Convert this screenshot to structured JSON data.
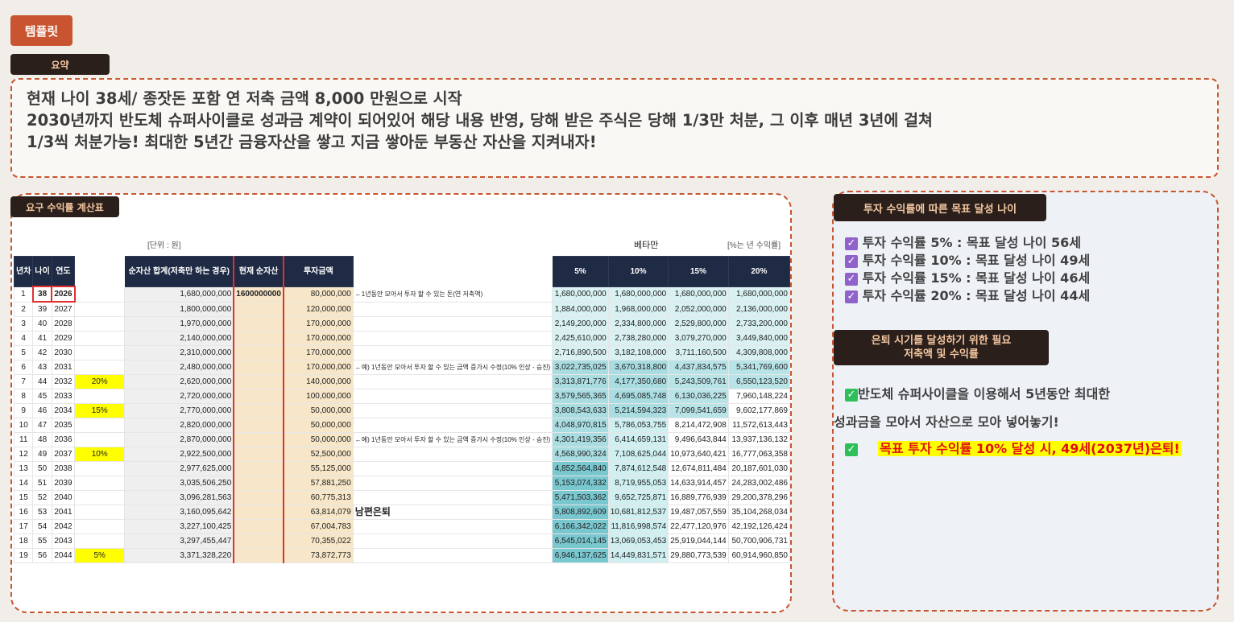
{
  "template_label": "템플릿",
  "summary": {
    "tag": "요약",
    "lines": [
      "현재 나이 38세/ 종잣돈 포함 연 저축 금액 8,000 만원으로 시작",
      "2030년까지 반도체 슈퍼사이클로 성과금 계약이 되어있어 해당 내용 반영, 당해 받은 주식은 당해 1/3만 처분, 그 이후 매년 3년에 걸쳐",
      "1/3씩 처분가능! 최대한 5년간 금융자산을 쌓고 지금 쌓아둔 부동산 자산을 지켜내자!"
    ]
  },
  "calc": {
    "tag": "요구 수익률 계산표",
    "unit_label": "[단위 : 원]",
    "beta_label": "베타만",
    "annual_return_label": "[%는 년 수익률]",
    "headers": [
      "년차",
      "나이",
      "연도",
      "",
      "순자산 합계(저축만 하는 경우)",
      "현재 순자산",
      "투자금액",
      "",
      "5%",
      "10%",
      "15%",
      "20%"
    ],
    "rows": [
      [
        "1",
        "38",
        "2026",
        "",
        "1,680,000,000",
        "1600000000",
        "80,000,000",
        "←1년동안 모아서 투자 할 수 있는 돈(연 저축액)",
        "1,680,000,000",
        "1,680,000,000",
        "1,680,000,000",
        "1,680,000,000"
      ],
      [
        "2",
        "39",
        "2027",
        "",
        "1,800,000,000",
        "",
        "120,000,000",
        "",
        "1,884,000,000",
        "1,968,000,000",
        "2,052,000,000",
        "2,136,000,000"
      ],
      [
        "3",
        "40",
        "2028",
        "",
        "1,970,000,000",
        "",
        "170,000,000",
        "",
        "2,149,200,000",
        "2,334,800,000",
        "2,529,800,000",
        "2,733,200,000"
      ],
      [
        "4",
        "41",
        "2029",
        "",
        "2,140,000,000",
        "",
        "170,000,000",
        "",
        "2,425,610,000",
        "2,738,280,000",
        "3,079,270,000",
        "3,449,840,000"
      ],
      [
        "5",
        "42",
        "2030",
        "",
        "2,310,000,000",
        "",
        "170,000,000",
        "",
        "2,716,890,500",
        "3,182,108,000",
        "3,711,160,500",
        "4,309,808,000"
      ],
      [
        "6",
        "43",
        "2031",
        "",
        "2,480,000,000",
        "",
        "170,000,000",
        "←예) 1년동안 모아서 투자 할 수 있는 금액 증가시 수정(10% 인상 - 승진)",
        "3,022,735,025",
        "3,670,318,800",
        "4,437,834,575",
        "5,341,769,600"
      ],
      [
        "7",
        "44",
        "2032",
        "20%",
        "2,620,000,000",
        "",
        "140,000,000",
        "",
        "3,313,871,776",
        "4,177,350,680",
        "5,243,509,761",
        "6,550,123,520"
      ],
      [
        "8",
        "45",
        "2033",
        "",
        "2,720,000,000",
        "",
        "100,000,000",
        "",
        "3,579,565,365",
        "4,695,085,748",
        "6,130,036,225",
        "7,960,148,224"
      ],
      [
        "9",
        "46",
        "2034",
        "15%",
        "2,770,000,000",
        "",
        "50,000,000",
        "",
        "3,808,543,633",
        "5,214,594,323",
        "7,099,541,659",
        "9,602,177,869"
      ],
      [
        "10",
        "47",
        "2035",
        "",
        "2,820,000,000",
        "",
        "50,000,000",
        "",
        "4,048,970,815",
        "5,786,053,755",
        "8,214,472,908",
        "11,572,613,443"
      ],
      [
        "11",
        "48",
        "2036",
        "",
        "2,870,000,000",
        "",
        "50,000,000",
        "←예) 1년동안 모아서 투자 할 수 있는 금액 증가시 수정(10% 인상 - 승진)",
        "4,301,419,356",
        "6,414,659,131",
        "9,496,643,844",
        "13,937,136,132"
      ],
      [
        "12",
        "49",
        "2037",
        "10%",
        "2,922,500,000",
        "",
        "52,500,000",
        "",
        "4,568,990,324",
        "7,108,625,044",
        "10,973,640,421",
        "16,777,063,358"
      ],
      [
        "13",
        "50",
        "2038",
        "",
        "2,977,625,000",
        "",
        "55,125,000",
        "",
        "4,852,564,840",
        "7,874,612,548",
        "12,674,811,484",
        "20,187,601,030"
      ],
      [
        "14",
        "51",
        "2039",
        "",
        "3,035,506,250",
        "",
        "57,881,250",
        "",
        "5,153,074,332",
        "8,719,955,053",
        "14,633,914,457",
        "24,283,002,486"
      ],
      [
        "15",
        "52",
        "2040",
        "",
        "3,096,281,563",
        "",
        "60,775,313",
        "",
        "5,471,503,362",
        "9,652,725,871",
        "16,889,776,939",
        "29,200,378,296"
      ],
      [
        "16",
        "53",
        "2041",
        "",
        "3,160,095,642",
        "",
        "63,814,079",
        "남편은퇴",
        "5,808,892,609",
        "10,681,812,537",
        "19,487,057,559",
        "35,104,268,034"
      ],
      [
        "17",
        "54",
        "2042",
        "",
        "3,227,100,425",
        "",
        "67,004,783",
        "",
        "6,166,342,022",
        "11,816,998,574",
        "22,477,120,976",
        "42,192,126,424"
      ],
      [
        "18",
        "55",
        "2043",
        "",
        "3,297,455,447",
        "",
        "70,355,022",
        "",
        "6,545,014,145",
        "13,069,053,453",
        "25,919,044,144",
        "50,700,906,731"
      ],
      [
        "19",
        "56",
        "2044",
        "5%",
        "3,371,328,220",
        "",
        "73,872,773",
        "",
        "6,946,137,625",
        "14,449,831,571",
        "29,880,773,539",
        "60,914,960,850"
      ]
    ]
  },
  "goals": {
    "tag": "투자 수익률에 따른 목표 달성 나이",
    "items": [
      "투자 수익률 5% :  목표 달성 나이 56세",
      "투자 수익률 10% : 목표 달성 나이 49세",
      "투자 수익률 15% : 목표 달성 나이 46세",
      "투자 수익률 20% : 목표 달성 나이 44세"
    ]
  },
  "retire": {
    "tag_line1": "은퇴 시기를 달성하기 위한 필요",
    "tag_line2": "저축액 및 수익률",
    "line1": "반도체 슈퍼사이클을 이용해서 5년동안 최대한",
    "line2": "성과금을 모아서 자산으로 모아 넣어놓기!",
    "highlight": "목표 투자 수익률 10% 달성 시, 49세(2037년)은퇴!"
  },
  "colors": {
    "accent": "#c8552f",
    "tag_bg": "#2a1f1b",
    "header_navy": "#1f2a44",
    "highlight_yellow": "#ffff00",
    "highlight_red": "#e01010",
    "invest_fill": "#f7e6c8",
    "teal_light": "#cdeef0",
    "teal_mid": "#9ad9de",
    "teal_dark": "#5fb8c4"
  },
  "icons": {
    "check_purple": "checkbox-checked-icon",
    "check_green": "check-mark-icon"
  }
}
